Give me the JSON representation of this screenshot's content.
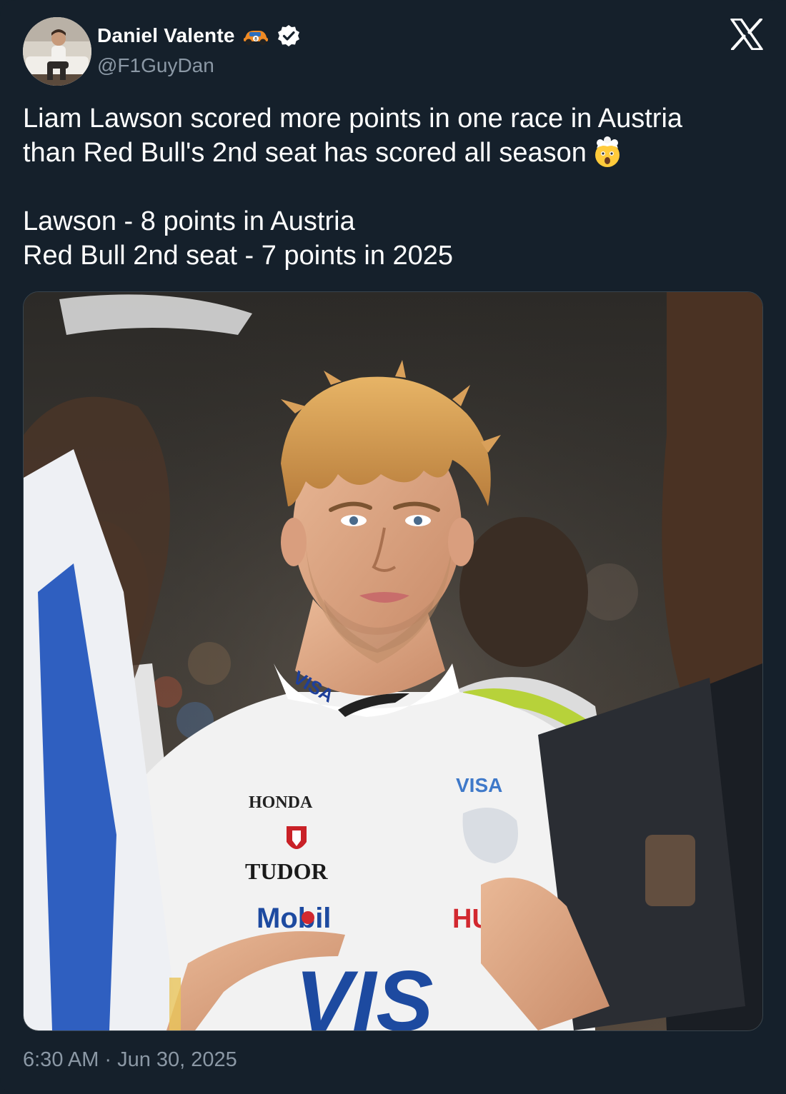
{
  "author": {
    "display_name": "Daniel Valente",
    "handle": "@F1GuyDan",
    "verified": true,
    "name_emoji": "race-car-emoji",
    "avatar": "profile-photo"
  },
  "platform": {
    "logo": "x-logo-icon"
  },
  "tweet": {
    "line1": "Liam Lawson scored more points in one race in Austria",
    "line2": "than Red Bull's 2nd seat has scored all season",
    "line2_emoji": "exploding-head-emoji",
    "line3": "Lawson - 8 points in Austria",
    "line4": "Red Bull 2nd seat - 7 points in 2025"
  },
  "media": {
    "type": "photo",
    "suit_sponsors": [
      "HONDA",
      "TUDOR",
      "Mobil",
      "VISA",
      "HUGO"
    ]
  },
  "meta": {
    "time": "6:30 AM",
    "separator": "·",
    "date": "Jun 30, 2025"
  },
  "colors": {
    "background": "#15202b",
    "text_primary": "#ffffff",
    "text_secondary": "#8b98a5",
    "verified": "#ffffff"
  }
}
